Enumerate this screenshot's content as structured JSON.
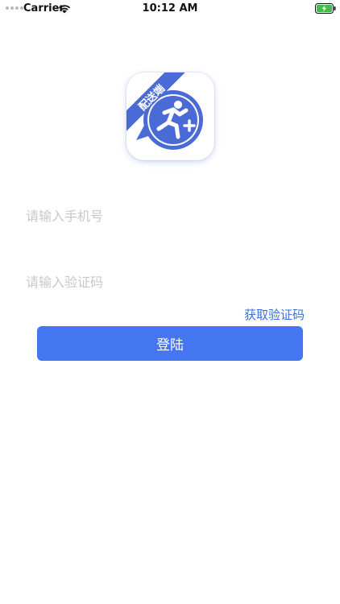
{
  "status_bar": {
    "carrier": "Carrier",
    "time": "10:12 AM",
    "battery_state": "charging",
    "icons": [
      "signal-dots-icon",
      "wifi-icon",
      "battery-charging-icon"
    ],
    "battery_color": "#3fbf4a"
  },
  "logo": {
    "ribbon_text": "配送端",
    "icon": "delivery-runner-icon",
    "brand_color": "#4a6bd6"
  },
  "login_form": {
    "phone_placeholder": "请输入手机号",
    "code_placeholder": "请输入验证码",
    "get_code_label": "获取验证码",
    "login_label": "登陆"
  },
  "colors": {
    "accent": "#4476f2",
    "link": "#3b6fd9",
    "placeholder": "#c8c8c8"
  }
}
